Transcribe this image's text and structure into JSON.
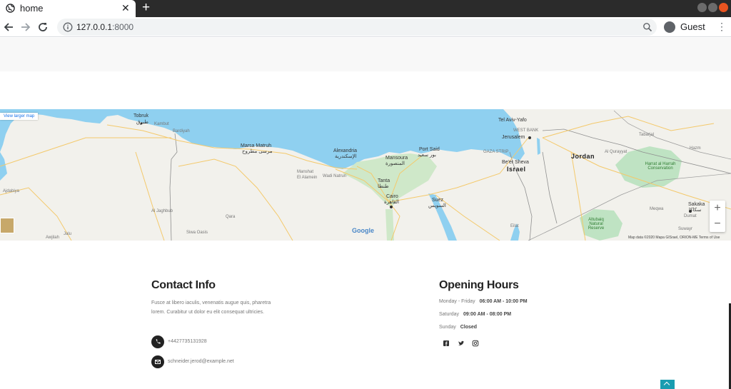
{
  "browser": {
    "tab_title": "home",
    "url_host": "127.0.0.1",
    "url_port": ":8000",
    "profile_label": "Guest",
    "colors": {
      "tabbar": "#2b2b2b",
      "close_button": "#e95420"
    }
  },
  "map": {
    "larger_map_link": "View larger map",
    "google_logo": "Google",
    "attribution": "Map data ©2020 Mapa GISrael, ORION-ME   Terms of Use",
    "zoom_in": "+",
    "zoom_out": "−",
    "labels": {
      "tobruk": "Tobruk",
      "tobruk_ar": "طبرق",
      "kambut": "Kambut",
      "bardiyah": "Bardiyah",
      "marsa_matruh": "Marsa Matruh",
      "marsa_matruh_ar": "مرسى مطروح",
      "alexandria": "Alexandria",
      "alexandria_ar": "الإسكندرية",
      "mansoura": "Mansoura",
      "mansoura_ar": "المنصورة",
      "port_said": "Port Said",
      "port_said_ar": "بور سعيد",
      "tanta": "Tanta",
      "tanta_ar": "طنطا",
      "cairo": "Cairo",
      "cairo_ar": "القاهرة",
      "suez": "Suez",
      "suez_ar": "السويس",
      "tel_aviv": "Tel Aviv-Yafo",
      "jerusalem": "Jerusalem",
      "west_bank": "WEST BANK",
      "gaza_strip": "GAZA STRIP",
      "beer_sheva": "Be'er Sheva",
      "israel": "Israel",
      "jordan": "Jordan",
      "al_quwayrah": "Al Qurayyat",
      "harrat": "Harrat al Harrah Conservation",
      "al_jaghbub": "Al Jaghbub",
      "siwa": "Siwa Oasis",
      "qara": "Qara",
      "ajdabiya": "Ajdabiya",
      "jalu": "Jalu",
      "awjila": "Awjilah",
      "eilat": "Eilat",
      "altubaiq": "Altubaiq Natural Reserve",
      "sakaka": "Sakaka",
      "sakaka_ar": "سكاكا",
      "dumat": "Dumat",
      "suwayr": "Suwayr",
      "mansha": "Manshat",
      "wadi": "Wadi Natrun",
      "alamein": "El Alamein",
      "tabarjal": "Tabarjal",
      "hazm": "Hazm",
      "meqwa": "Meqwa"
    }
  },
  "contact": {
    "title": "Contact Info",
    "about": "Fusce at libero iaculis, venenatis augue quis, pharetra lorem. Curabitur ut dolor eu elit consequat ultricies.",
    "phone": "+4427735131928",
    "email": "schneider.jerod@example.net"
  },
  "hours": {
    "title": "Opening Hours",
    "rows": [
      {
        "day": "Monday - Friday",
        "time": "06:00 AM - 10:00 PM"
      },
      {
        "day": "Saturday",
        "time": "09:00 AM - 08:00 PM"
      },
      {
        "day": "Sunday",
        "time": "Closed"
      }
    ]
  },
  "social": [
    "facebook-icon",
    "twitter-icon",
    "instagram-icon"
  ],
  "accent_color": "#1a9cb0"
}
